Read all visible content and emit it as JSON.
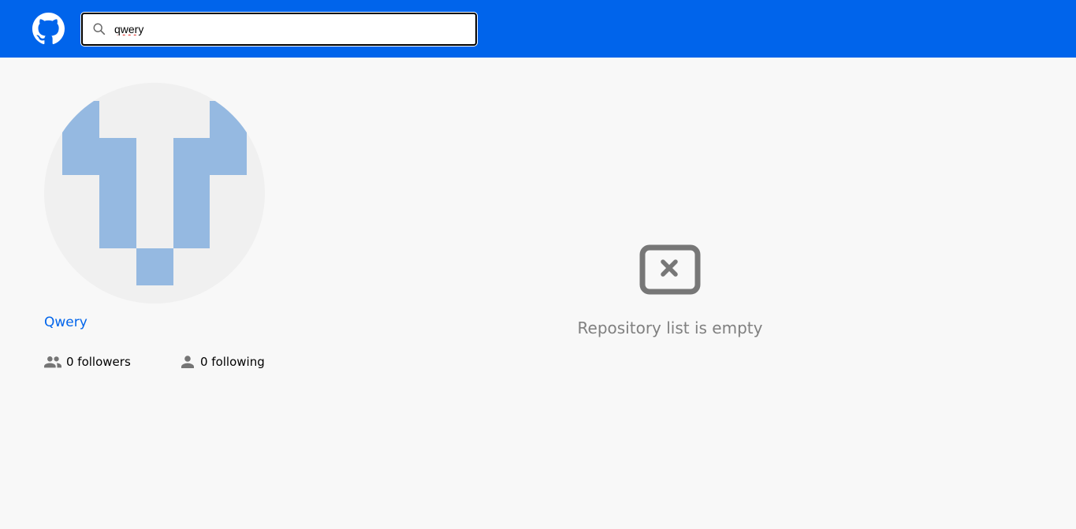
{
  "header": {
    "logo_icon": "github-icon",
    "background_color": "#0064eb"
  },
  "search": {
    "icon": "search-icon",
    "value": "qwery"
  },
  "profile": {
    "avatar_icon": "identicon-avatar",
    "avatar_color": "#95b9e1",
    "name": "Qwery",
    "followers": {
      "icon": "people-icon",
      "label": "0 followers"
    },
    "following": {
      "icon": "person-icon",
      "label": "0 following"
    }
  },
  "repositories": {
    "empty_icon": "empty-box-x-icon",
    "empty_message": "Repository list is empty"
  }
}
